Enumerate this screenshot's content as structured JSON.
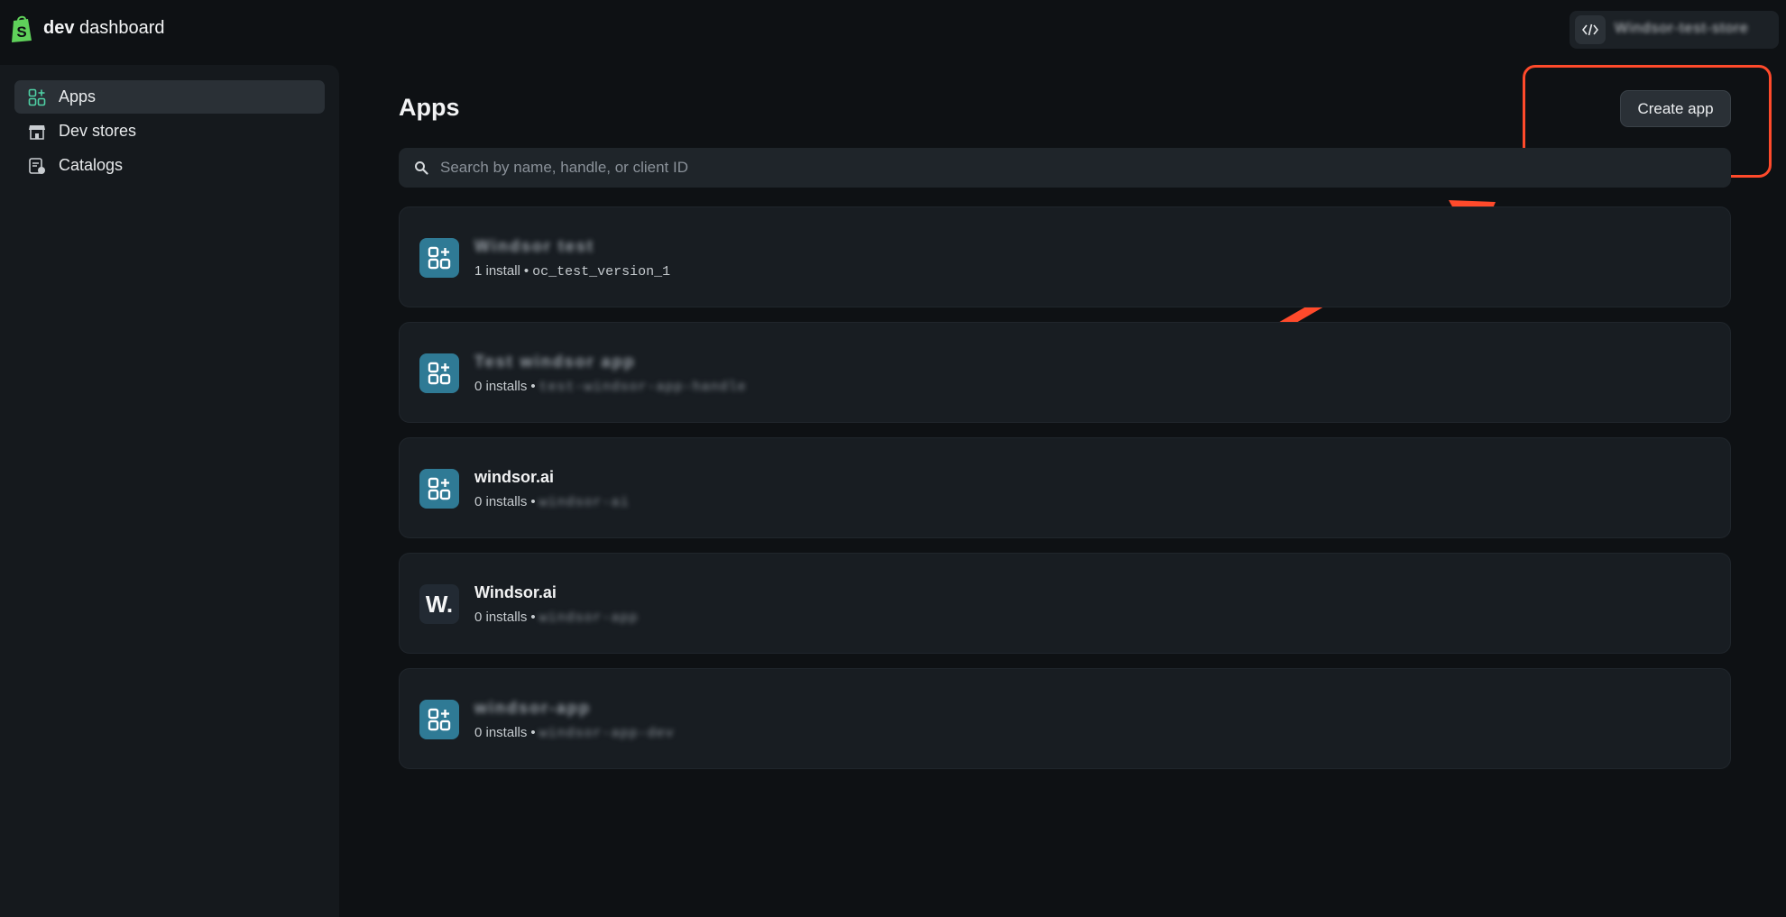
{
  "header": {
    "brand_bold": "dev",
    "brand_rest": "dashboard",
    "account_name": "Windsor-test-store"
  },
  "sidebar": {
    "items": [
      {
        "label": "Apps",
        "icon": "apps-icon",
        "active": true
      },
      {
        "label": "Dev stores",
        "icon": "store-icon",
        "active": false
      },
      {
        "label": "Catalogs",
        "icon": "catalog-icon",
        "active": false
      }
    ]
  },
  "main": {
    "title": "Apps",
    "create_label": "Create app",
    "search_placeholder": "Search by name, handle, or client ID"
  },
  "apps": [
    {
      "name": "Windsor test",
      "installs": "1 install",
      "handle": "oc_test_version_1",
      "icon": "apps-plus-icon",
      "name_blurred": true,
      "handle_blurred": false
    },
    {
      "name": "Test windsor app",
      "installs": "0 installs",
      "handle": "test-windsor-app-handle",
      "icon": "apps-plus-icon",
      "name_blurred": true,
      "handle_blurred": true
    },
    {
      "name": "windsor.ai",
      "installs": "0 installs",
      "handle": "windsor-ai",
      "icon": "apps-plus-icon",
      "name_blurred": false,
      "handle_blurred": true
    },
    {
      "name": "Windsor.ai",
      "installs": "0 installs",
      "handle": "windsor-app",
      "icon": "windsor-logo-icon",
      "name_blurred": false,
      "handle_blurred": true
    },
    {
      "name": "windsor-app",
      "installs": "0 installs",
      "handle": "windsor-app-dev",
      "icon": "apps-plus-icon",
      "name_blurred": true,
      "handle_blurred": true
    }
  ],
  "colors": {
    "background": "#0e1114",
    "sidebar": "#15191d",
    "card": "#181d22",
    "app_icon_teal": "#2f7a95",
    "annotation": "#ff4a2b",
    "shopify_green": "#5fd15a"
  }
}
